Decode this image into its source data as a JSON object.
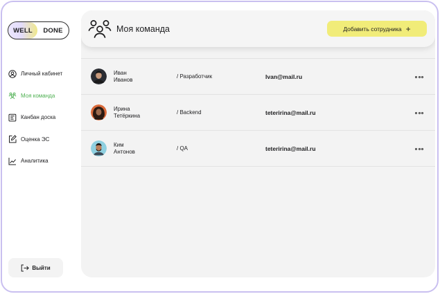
{
  "logo": {
    "left": "WELL",
    "right": "DONE"
  },
  "sidebar": {
    "items": [
      {
        "label": "Личный кабинет",
        "icon": "user-circle-icon",
        "active": false
      },
      {
        "label": "Моя команда",
        "icon": "team-icon",
        "active": true
      },
      {
        "label": "Канбан доска",
        "icon": "kanban-icon",
        "active": false
      },
      {
        "label": "Оценка ЭС",
        "icon": "edit-icon",
        "active": false
      },
      {
        "label": "Аналитика",
        "icon": "chart-line-icon",
        "active": false
      }
    ],
    "logout_label": "Выйти"
  },
  "header": {
    "title": "Моя команда",
    "add_button_label": "Добавить сотрудника",
    "add_button_icon": "+"
  },
  "employees": [
    {
      "first_name": "Иван",
      "last_name": "Иванов",
      "role": "/ Разработчик",
      "email": "Ivan@mail.ru"
    },
    {
      "first_name": "Ирина",
      "last_name": "Тетёркина",
      "role": "/ Backend",
      "email": "teteririna@mail.ru"
    },
    {
      "first_name": "Ким",
      "last_name": "Антонов",
      "role": "/ QA",
      "email": "teteririna@mail.ru"
    }
  ],
  "colors": {
    "accent_green": "#4caf50",
    "add_button_bg": "#f1ec79",
    "frame_border": "#c9bff0"
  }
}
